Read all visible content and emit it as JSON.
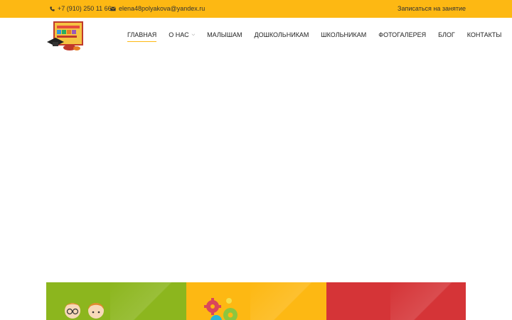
{
  "topbar": {
    "phone": "+7 (910) 250 11 66",
    "email": "elena48polyakova@yandex.ru",
    "signup_label": "Записаться на занятие",
    "background": "#fdb813"
  },
  "header": {
    "logo_icon": "school-abacus-logo",
    "nav": [
      {
        "label": "ГЛАВНАЯ",
        "active": true
      },
      {
        "label": "О НАС",
        "has_dropdown": true
      },
      {
        "label": "МАЛЫШАМ"
      },
      {
        "label": "ДОШКОЛЬНИКАМ"
      },
      {
        "label": "ШКОЛЬНИКАМ"
      },
      {
        "label": "ФОТОГАЛЕРЕЯ"
      },
      {
        "label": "БЛОГ"
      },
      {
        "label": "КОНТАКТЫ"
      }
    ]
  },
  "cards": [
    {
      "color": "#8cb61e",
      "icon": "children-icon"
    },
    {
      "color": "#fdb813",
      "icon": "gears-icon"
    },
    {
      "color": "#d53437",
      "icon": ""
    }
  ]
}
